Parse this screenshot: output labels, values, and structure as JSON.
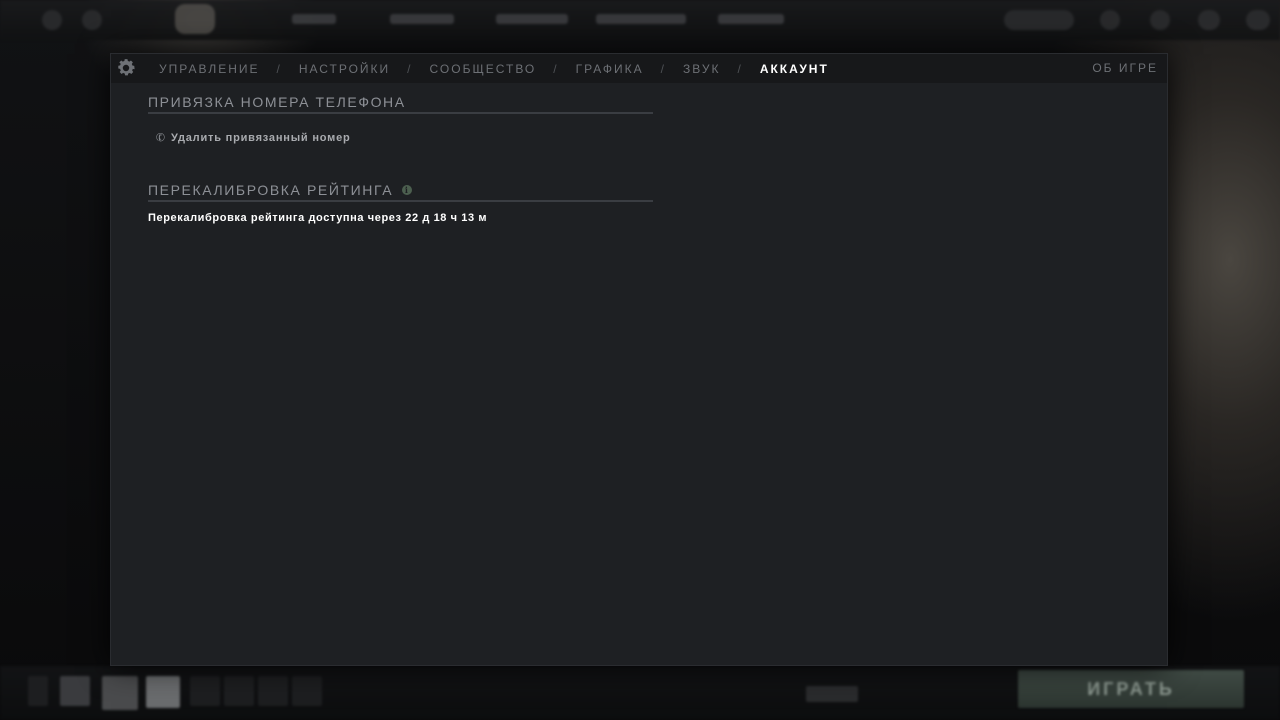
{
  "nav": {
    "items": [
      {
        "label": "УПРАВЛЕНИЕ",
        "active": false
      },
      {
        "label": "НАСТРОЙКИ",
        "active": false
      },
      {
        "label": "СООБЩЕСТВО",
        "active": false
      },
      {
        "label": "ГРАФИКА",
        "active": false
      },
      {
        "label": "ЗВУК",
        "active": false
      },
      {
        "label": "АККАУНТ",
        "active": true
      }
    ],
    "separator": "/",
    "about_label": "ОБ ИГРЕ",
    "settings_icon": "gear-icon"
  },
  "phone_section": {
    "title": "ПРИВЯЗКА НОМЕРА ТЕЛЕФОНА",
    "remove_label": "Удалить привязанный номер",
    "remove_icon": "phone-icon"
  },
  "recalibration_section": {
    "title": "ПЕРЕКАЛИБРОВКА РЕЙТИНГА",
    "info_icon": "info-icon",
    "status_text": "Перекалибровка рейтинга доступна через 22 д 18 ч 13 м"
  },
  "bottom": {
    "play_label": "ИГРАТЬ"
  },
  "colors": {
    "panel_bg": "#1e2023",
    "nav_bg": "#17181a",
    "active_tab": "#ffffff",
    "inactive_tab": "#6d7075",
    "accent_info": "#4c5f4f"
  }
}
